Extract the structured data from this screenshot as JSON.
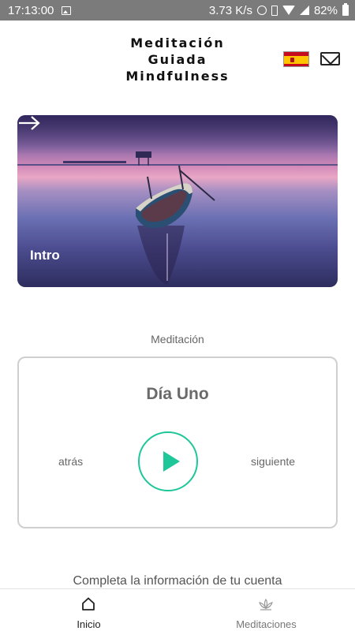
{
  "status_bar": {
    "time": "17:13:00",
    "speed": "3.73 K/s",
    "battery": "82%"
  },
  "header": {
    "title_lines": [
      "Meditación",
      "Guiada",
      "Mindfulness"
    ],
    "flag_icon": "spain-flag-icon",
    "mail_icon": "mail-icon"
  },
  "hero": {
    "label": "Intro",
    "arrow_icon": "arrow-right-icon"
  },
  "meditation": {
    "section_label": "Meditación",
    "day_title": "Día Uno",
    "prev_label": "atrás",
    "next_label": "siguiente",
    "play_icon": "play-icon",
    "accent": "#1ec79a"
  },
  "account_prompt": "Completa la información de tu cuenta",
  "bottom_nav": {
    "items": [
      {
        "label": "Inicio",
        "icon": "home-icon",
        "active": true
      },
      {
        "label": "Meditaciones",
        "icon": "lotus-icon",
        "active": false
      }
    ]
  }
}
